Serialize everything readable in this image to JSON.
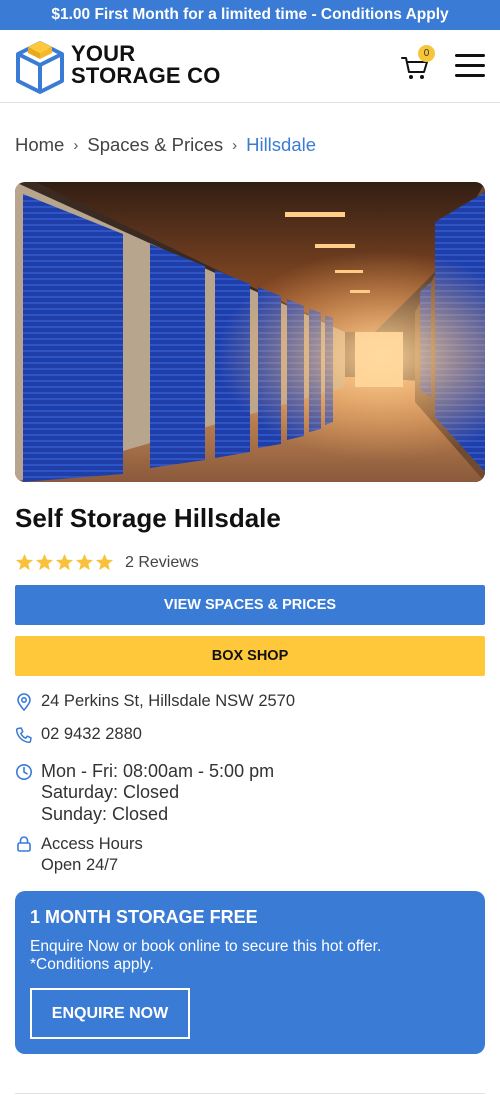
{
  "promo": {
    "text": "$1.00 First Month for a limited time - Conditions Apply"
  },
  "header": {
    "logo_line1": "YOUR",
    "logo_line2": "STORAGE CO",
    "cart_count": "0"
  },
  "breadcrumb": {
    "home": "Home",
    "spaces": "Spaces & Prices",
    "current": "Hillsdale"
  },
  "facility": {
    "title": "Self Storage Hillsdale",
    "rating": 5,
    "reviews": "2 Reviews"
  },
  "buttons": {
    "view_spaces": "VIEW SPACES & PRICES",
    "box_shop": "BOX SHOP"
  },
  "contact": {
    "address": "24 Perkins St, Hillsdale NSW 2570",
    "phone": "02 9432 2880",
    "hours_weekday": "Mon - Fri: 08:00am - 5:00 pm",
    "hours_saturday": "Saturday: Closed",
    "hours_sunday": "Sunday: Closed",
    "access_label": "Access Hours",
    "access_value": "Open 24/7"
  },
  "offer": {
    "title": "1 MONTH STORAGE FREE",
    "text_line1": "Enquire Now or book online to secure this hot offer.",
    "text_line2": "*Conditions apply.",
    "button": "ENQUIRE NOW"
  },
  "icons": {
    "logo": "storage-box-logo-icon",
    "cart": "cart-icon",
    "menu": "hamburger-menu-icon",
    "address": "map-pin-icon",
    "phone": "phone-icon",
    "hours": "clock-icon",
    "access": "lock-icon",
    "star": "star-icon"
  },
  "colors": {
    "brand_blue": "#3a7bd5",
    "brand_yellow": "#ffc73a",
    "star_yellow": "#f9c23c"
  }
}
